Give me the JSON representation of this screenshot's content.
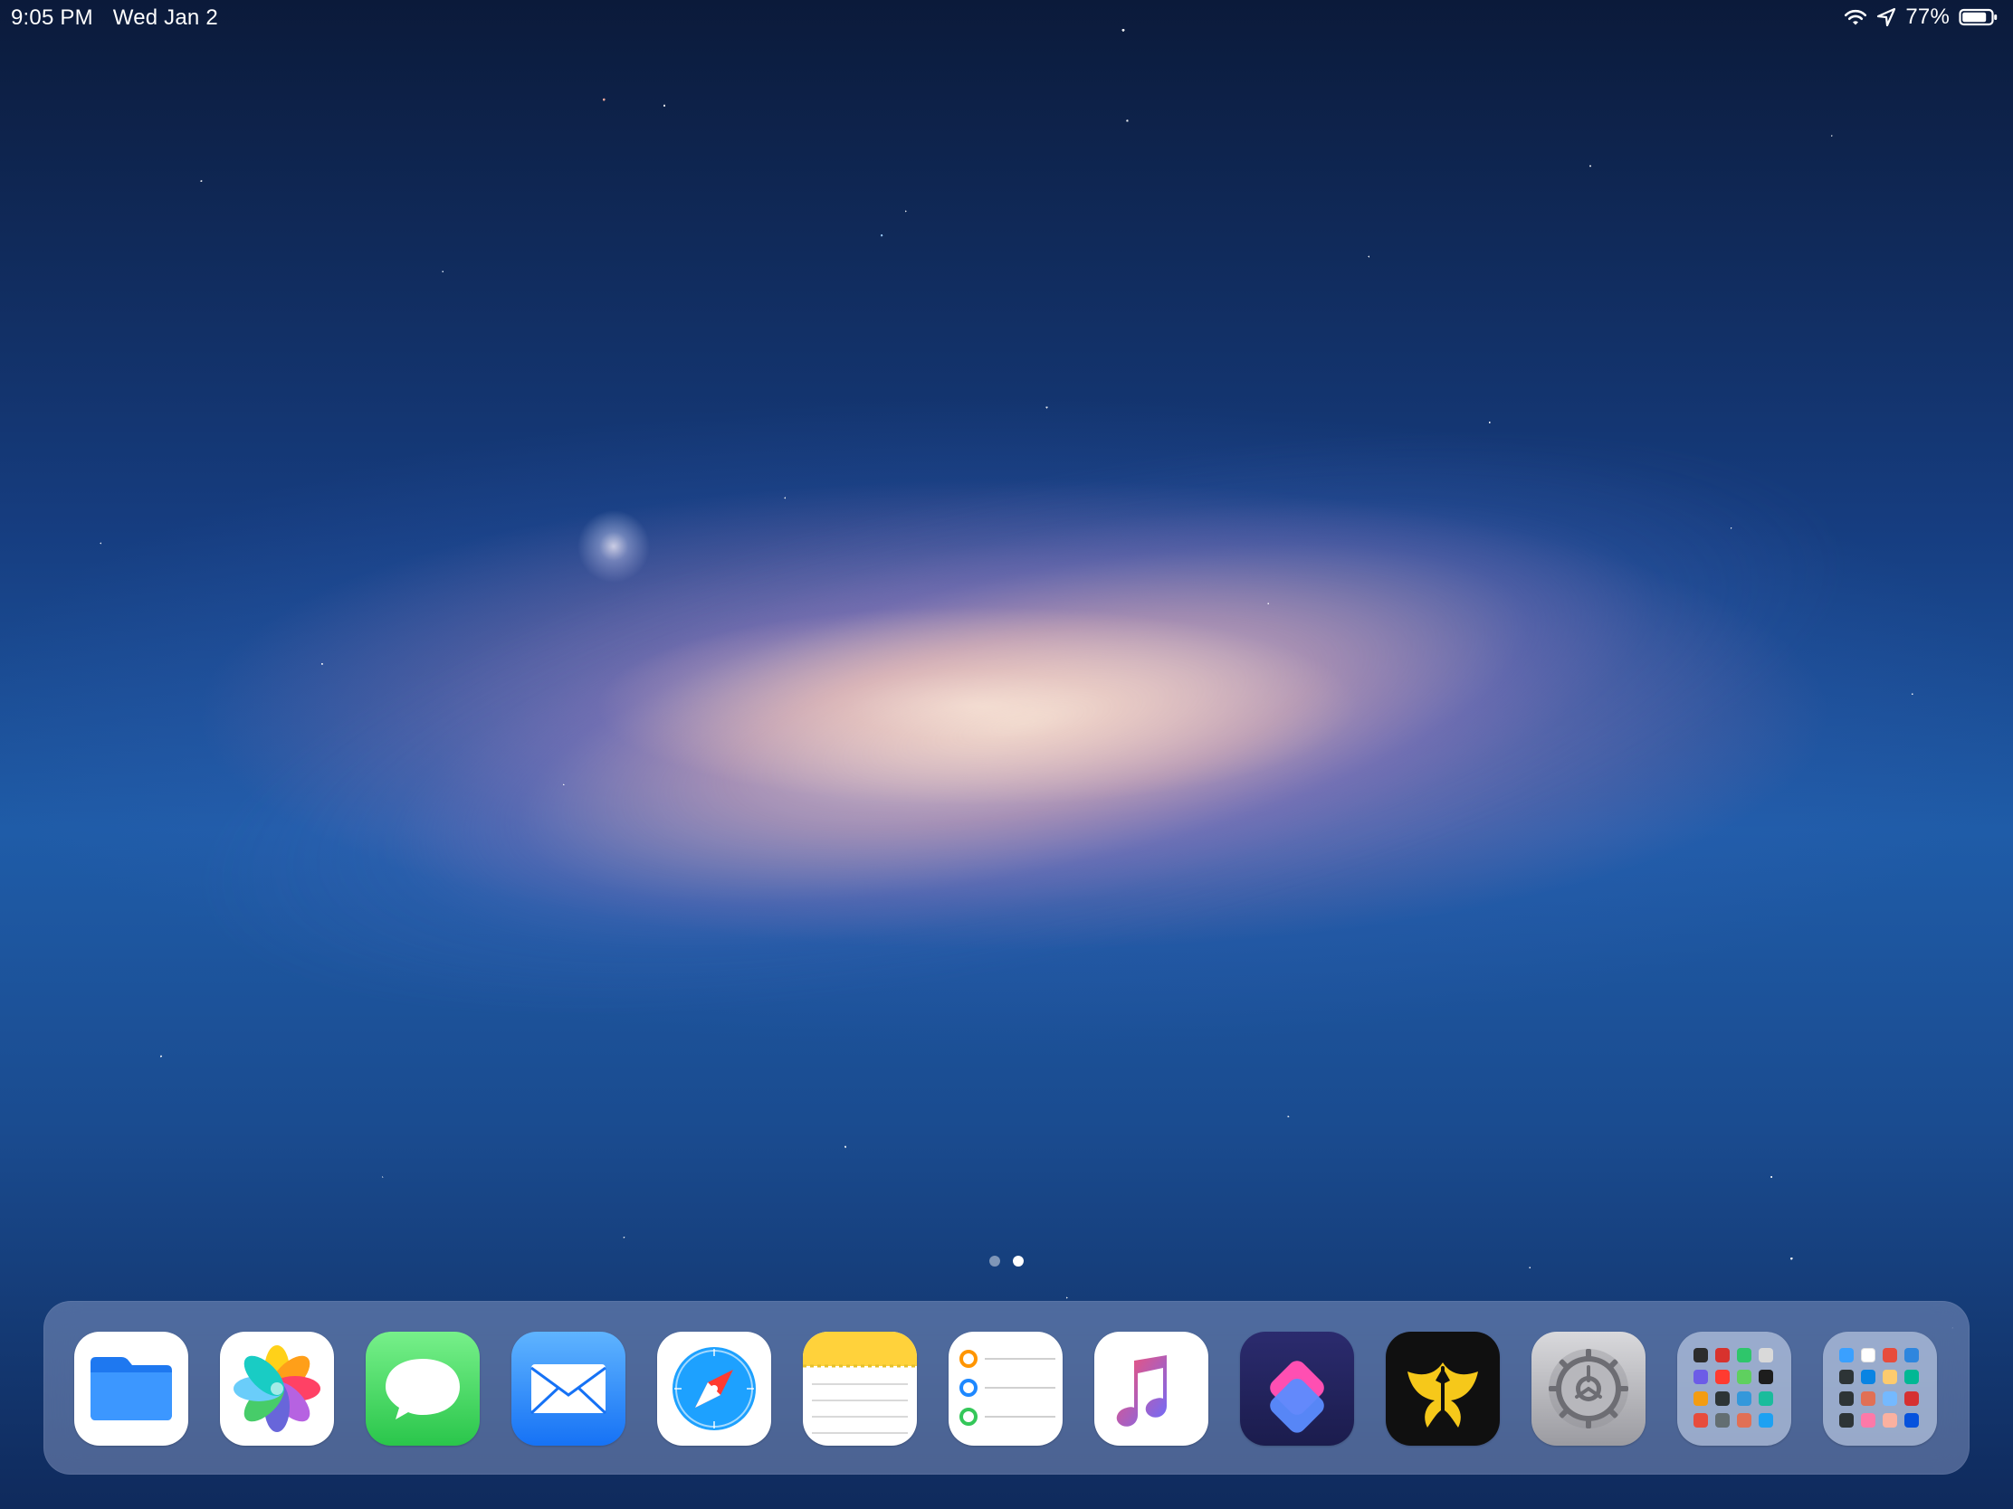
{
  "status_bar": {
    "time": "9:05 PM",
    "date": "Wed Jan 2",
    "battery_percent": "77%",
    "icons": [
      "wifi-icon",
      "location-arrow-icon",
      "battery-icon"
    ]
  },
  "page_indicator": {
    "pages": 2,
    "active_index": 1
  },
  "dock": {
    "apps": [
      {
        "name": "Files",
        "icon": "files-icon"
      },
      {
        "name": "Photos",
        "icon": "photos-icon"
      },
      {
        "name": "Messages",
        "icon": "messages-icon"
      },
      {
        "name": "Mail",
        "icon": "mail-icon"
      },
      {
        "name": "Safari",
        "icon": "safari-icon"
      },
      {
        "name": "Notes",
        "icon": "notes-icon"
      },
      {
        "name": "Reminders",
        "icon": "reminders-icon"
      },
      {
        "name": "Music",
        "icon": "music-icon"
      },
      {
        "name": "Shortcuts",
        "icon": "shortcuts-icon"
      },
      {
        "name": "Ulysses",
        "icon": "ulysses-icon"
      },
      {
        "name": "Settings",
        "icon": "settings-icon"
      },
      {
        "name": "Folder",
        "icon": "folder-icon"
      },
      {
        "name": "Folder",
        "icon": "folder-icon"
      }
    ]
  },
  "folder_mini_icons_1": [
    "#2c2c2c",
    "#d8322d",
    "#2ec66b",
    "#d9d9d9",
    "#6c5ce7",
    "#ff3b30",
    "#5fd05f",
    "#1d1d1d",
    "#f39c12",
    "#2d3436",
    "#3498db",
    "#1abc9c",
    "#e74c3c",
    "#636e72",
    "#e17055",
    "#1da1f2"
  ],
  "folder_mini_icons_2": [
    "#3aa0ff",
    "#ffffff",
    "#e74c3c",
    "#2e86de",
    "#2d3436",
    "#0984e3",
    "#fdcb6e",
    "#00b894",
    "#2d3436",
    "#e17055",
    "#74b9ff",
    "#d63031",
    "#2d3436",
    "#fd79a8",
    "#fab1a0",
    "#0652dd"
  ]
}
